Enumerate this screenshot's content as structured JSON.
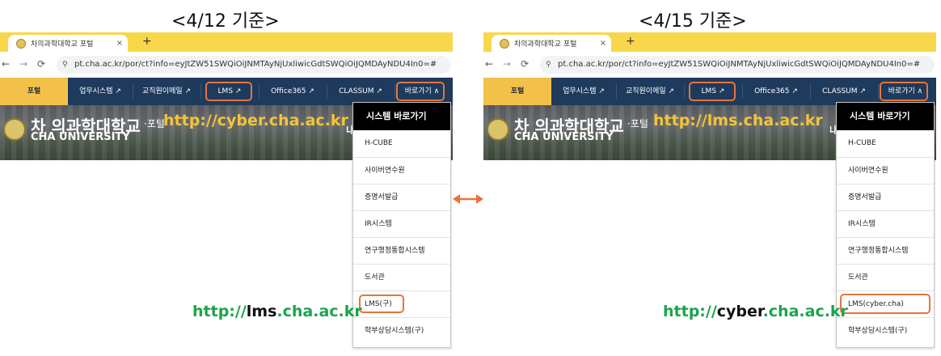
{
  "left": {
    "caption": "<4/12 기준>",
    "tab_title": "차의과학대학교 포털",
    "tab_close": "×",
    "new_tab": "+",
    "url": "pt.cha.ac.kr/por/ct?info=eyJtZW51SWQiOiJNMTAyNjUxliwicGdtSWQiOiJQMDAyNDU4In0=#",
    "gnb": [
      "포털",
      "업무시스템 ↗",
      "교직원이메일 ↗",
      "LMS ↗",
      "Office365 ↗",
      "CLASSUM ↗",
      "바로가기 ∧"
    ],
    "banner": {
      "ko": "차 의과학대학교",
      "portal": "·포털",
      "en": "CHA UNIVERSITY",
      "url": "http://cyber.cha.ac.kr",
      "extra": "내"
    },
    "dropdown": {
      "header": "시스템 바로가기",
      "items": [
        "H-CUBE",
        "사이버연수원",
        "증명서발급",
        "IR시스템",
        "연구행정통합시스템",
        "도서관",
        "LMS(구)",
        "학부상담시스템(구)"
      ]
    },
    "green_url": {
      "prefix": "http://",
      "mid": "lms",
      "suffix": ".cha.ac.kr"
    }
  },
  "right": {
    "caption": "<4/15 기준>",
    "tab_title": "차의과학대학교 포털",
    "tab_close": "×",
    "new_tab": "+",
    "url": "pt.cha.ac.kr/por/ct?info=eyJtZW51SWQiOiJNMTAyNjUxliwicGdtSWQiOiJQMDAyNDU4In0=#",
    "gnb": [
      "포털",
      "업무시스템 ↗",
      "교직원이메일 ↗",
      "LMS ↗",
      "Office365 ↗",
      "CLASSUM ↗",
      "바로가기 ∧"
    ],
    "banner": {
      "ko": "차 의과학대학교",
      "portal": "·포털",
      "en": "CHA UNIVERSITY",
      "url": "http://lms.cha.ac.kr",
      "extra": "내"
    },
    "dropdown": {
      "header": "시스템 바로가기",
      "items": [
        "H-CUBE",
        "사이버연수원",
        "증명서발급",
        "IR시스템",
        "연구행정통합시스템",
        "도서관",
        "LMS(cyber.cha)",
        "학부상담시스템(구)"
      ]
    },
    "green_url": {
      "prefix": "http://",
      "mid": "cyber",
      "suffix": ".cha.ac.kr"
    }
  },
  "icons": {
    "back": "←",
    "forward": "→",
    "reload": "⟳",
    "site_info": "⚲"
  },
  "colors": {
    "highlight": "#e8743b",
    "nav": "#1e3a5c",
    "nav_active": "#f3c14a",
    "tabbar": "#f8d84a",
    "green": "#1aa54b",
    "banner_url": "#f3c43a"
  }
}
